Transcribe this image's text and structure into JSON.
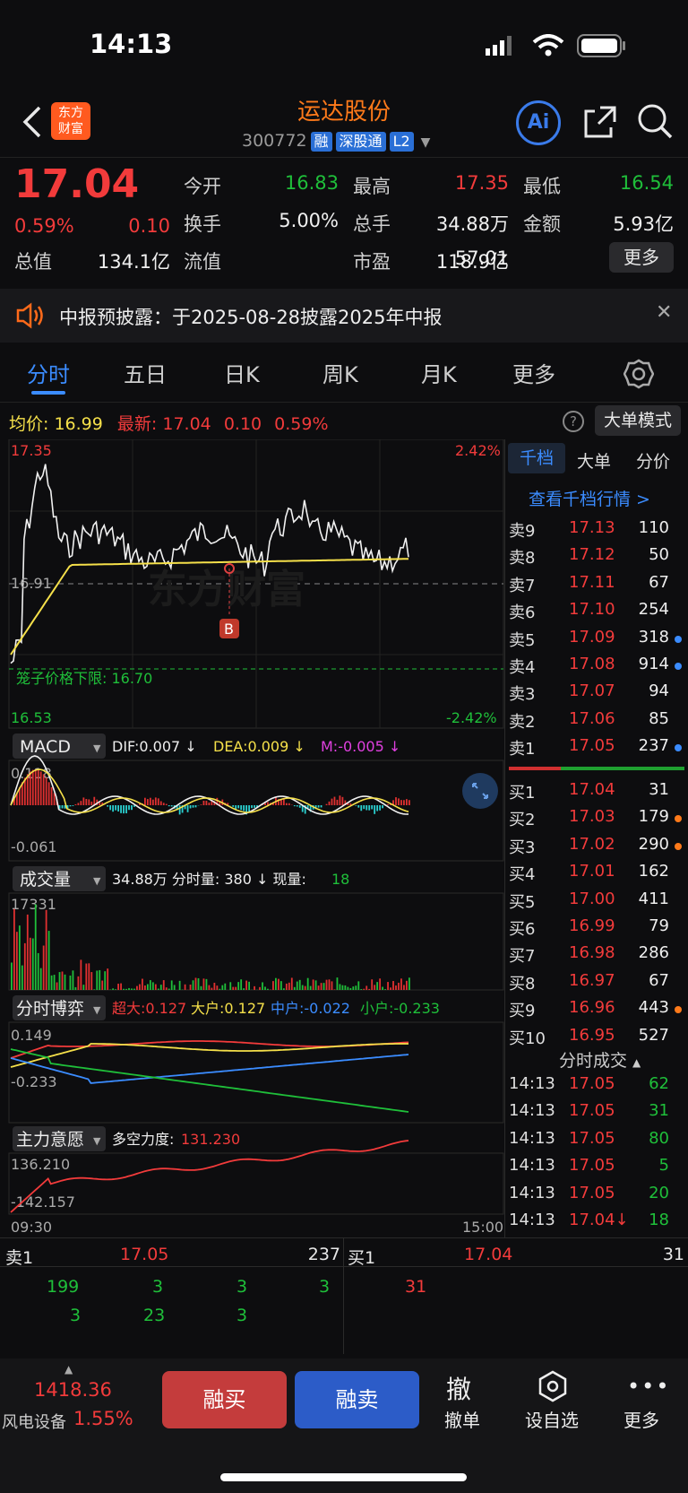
{
  "status": {
    "time": "14:13"
  },
  "header": {
    "title": "运达股份",
    "code": "300772",
    "tags": [
      "融",
      "深股通",
      "L2"
    ],
    "logo": "东方\n财富",
    "ai": "Ai"
  },
  "quote": {
    "price": "17.04",
    "pct": "0.59%",
    "chg": "0.10",
    "fields": [
      {
        "label": "今开",
        "value": "16.83",
        "color": "green"
      },
      {
        "label": "最高",
        "value": "17.35",
        "color": "red"
      },
      {
        "label": "最低",
        "value": "16.54",
        "color": "green"
      },
      {
        "label": "换手",
        "value": "5.00%",
        "color": "white"
      },
      {
        "label": "总手",
        "value": "34.88万",
        "color": "white"
      },
      {
        "label": "金额",
        "value": "5.93亿",
        "color": "white"
      },
      {
        "label": "总值",
        "value": "134.1亿",
        "color": "white"
      },
      {
        "label": "流值",
        "value": "118.9亿",
        "color": "white"
      },
      {
        "label": "市盈",
        "value": "57.01",
        "color": "white"
      }
    ],
    "more": "更多"
  },
  "notice": {
    "text": "中报预披露：于2025-08-28披露2025年中报"
  },
  "tabs": [
    "分时",
    "五日",
    "日K",
    "周K",
    "月K",
    "更多"
  ],
  "info_line": {
    "avg_label": "均价:",
    "avg": "16.99",
    "latest_label": "最新:",
    "latest": "17.04",
    "chg": "0.10",
    "pct": "0.59%",
    "mode": "大单模式"
  },
  "chart": {
    "top_price": "17.35",
    "top_pct": "2.42%",
    "bottom_price": "16.53",
    "bottom_pct": "-2.42%",
    "mid": "16.91",
    "limit_label": "笼子价格下限: 16.70",
    "b_marker": "B",
    "watermark": "东方财富",
    "macd": {
      "name": "MACD",
      "dif": "DIF:0.007 ↓",
      "dea": "DEA:0.009 ↓",
      "m": "M:-0.005 ↓",
      "top": "0.118",
      "bottom": "-0.061"
    },
    "vol": {
      "name": "成交量",
      "summary": "34.88万 分时量: 380 ↓ 现量:",
      "now": "18",
      "top": "17331"
    },
    "game": {
      "name": "分时博弈",
      "super": "超大:0.127",
      "big": "大户:0.127",
      "mid": "中户:-0.022",
      "small": "小户:-0.233",
      "top": "0.149",
      "bottom": "-0.233"
    },
    "main": {
      "name": "主力意愿",
      "label": "多空力度:",
      "value": "131.230",
      "top": "136.210",
      "bottom": "-142.157"
    },
    "time_start": "09:30",
    "time_end": "15:00"
  },
  "orderbook": {
    "tabs": [
      "千档",
      "大单",
      "分价"
    ],
    "view_link": "查看千档行情 >",
    "asks": [
      [
        "卖9",
        "17.13",
        "110"
      ],
      [
        "卖8",
        "17.12",
        "50"
      ],
      [
        "卖7",
        "17.11",
        "67"
      ],
      [
        "卖6",
        "17.10",
        "254"
      ],
      [
        "卖5",
        "17.09",
        "318"
      ],
      [
        "卖4",
        "17.08",
        "914"
      ],
      [
        "卖3",
        "17.07",
        "94"
      ],
      [
        "卖2",
        "17.06",
        "85"
      ],
      [
        "卖1",
        "17.05",
        "237"
      ]
    ],
    "bids": [
      [
        "买1",
        "17.04",
        "31"
      ],
      [
        "买2",
        "17.03",
        "179"
      ],
      [
        "买3",
        "17.02",
        "290"
      ],
      [
        "买4",
        "17.01",
        "162"
      ],
      [
        "买5",
        "17.00",
        "411"
      ],
      [
        "买6",
        "16.99",
        "79"
      ],
      [
        "买7",
        "16.98",
        "286"
      ],
      [
        "买8",
        "16.97",
        "67"
      ],
      [
        "买9",
        "16.96",
        "443"
      ],
      [
        "买10",
        "16.95",
        "527"
      ]
    ],
    "ticks_title": "分时成交",
    "ticks": [
      [
        "14:13",
        "17.05",
        "62"
      ],
      [
        "14:13",
        "17.05",
        "31"
      ],
      [
        "14:13",
        "17.05",
        "80"
      ],
      [
        "14:13",
        "17.05",
        "5"
      ],
      [
        "14:13",
        "17.05",
        "20"
      ],
      [
        "14:13",
        "17.04↓",
        "18"
      ]
    ]
  },
  "queue": {
    "sell_label": "卖1",
    "sell_price": "17.05",
    "sell_vol": "237",
    "buy_label": "买1",
    "buy_price": "17.04",
    "buy_vol": "31",
    "sell_orders": [
      "199",
      "3",
      "3",
      "3",
      "3",
      "23",
      "3"
    ],
    "buy_orders": [
      "31"
    ]
  },
  "footer": {
    "index_value": "1418.36",
    "index_name": "风电设备",
    "index_pct": "1.55%",
    "buy": "融买",
    "sell": "融卖",
    "cancel_icon": "撤",
    "cancel": "撤单",
    "watch": "设自选",
    "more": "更多"
  }
}
